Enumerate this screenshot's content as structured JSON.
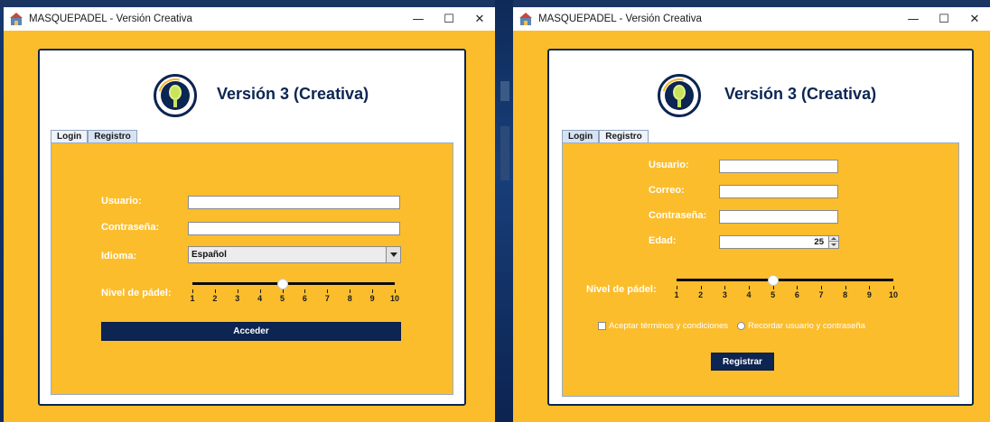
{
  "windows": [
    {
      "title": "MASQUEPADEL - Versión Creativa",
      "controls": {
        "minimize": "—",
        "maximize": "☐",
        "close": "✕"
      },
      "panel_title": "Versión 3 (Creativa)",
      "tabs": [
        {
          "label": "Login",
          "active": true
        },
        {
          "label": "Registro",
          "active": false
        }
      ],
      "form": {
        "usuario_label": "Usuario:",
        "usuario_value": "",
        "contrasena_label": "Contraseña:",
        "contrasena_value": "",
        "idioma_label": "Idioma:",
        "idioma_value": "Español",
        "nivel_label": "Nivel de pádel:",
        "nivel_value": 5,
        "nivel_ticks": [
          "1",
          "2",
          "3",
          "4",
          "5",
          "6",
          "7",
          "8",
          "9",
          "10"
        ],
        "submit_label": "Acceder"
      }
    },
    {
      "title": "MASQUEPADEL - Versión Creativa",
      "controls": {
        "minimize": "—",
        "maximize": "☐",
        "close": "✕"
      },
      "panel_title": "Versión 3 (Creativa)",
      "tabs": [
        {
          "label": "Login",
          "active": false
        },
        {
          "label": "Registro",
          "active": true
        }
      ],
      "form": {
        "usuario_label": "Usuario:",
        "usuario_value": "",
        "correo_label": "Correo:",
        "correo_value": "",
        "contrasena_label": "Contraseña:",
        "contrasena_value": "",
        "edad_label": "Edad:",
        "edad_value": "25",
        "nivel_label": "Nivel de pádel:",
        "nivel_value": 5,
        "nivel_ticks": [
          "1",
          "2",
          "3",
          "4",
          "5",
          "6",
          "7",
          "8",
          "9",
          "10"
        ],
        "terms_label": "Aceptar términos y condiciones",
        "terms_checked": false,
        "remember_label": "Recordar usuario y contraseña",
        "remember_checked": false,
        "submit_label": "Registrar"
      }
    }
  ],
  "colors": {
    "accent": "#fbbd2c",
    "navy": "#0c2552",
    "desktop": "#0c2552"
  }
}
